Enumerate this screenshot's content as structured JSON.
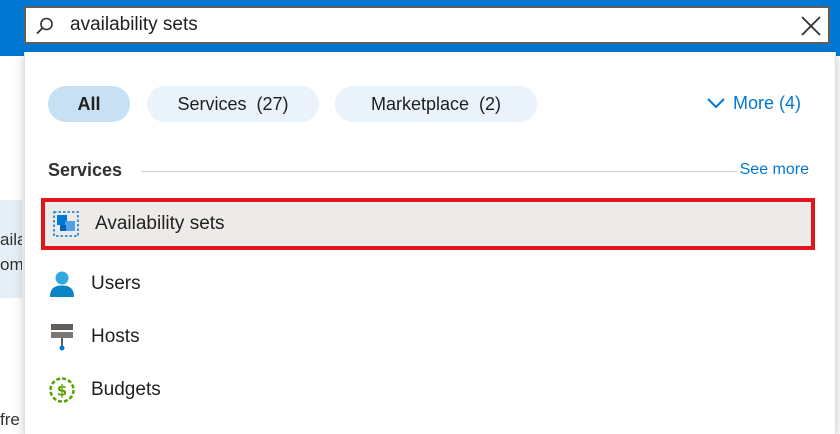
{
  "search": {
    "value": "availability sets"
  },
  "background": {
    "line1": "aila",
    "line2": "om",
    "line3": "fre"
  },
  "filters": {
    "all_label": "All",
    "services_label": "Services  (27)",
    "marketplace_label": "Marketplace  (2)",
    "more_label": "More (4)"
  },
  "services_section": {
    "title": "Services",
    "see_more": "See more",
    "items": [
      {
        "label": "Availability sets",
        "icon": "availability-sets-icon"
      },
      {
        "label": "Users",
        "icon": "user-icon"
      },
      {
        "label": "Hosts",
        "icon": "hosts-icon"
      },
      {
        "label": "Budgets",
        "icon": "budgets-icon"
      }
    ]
  },
  "colors": {
    "accent": "#0078d4",
    "highlight_border": "#e3151c",
    "pill_selected": "#c7e0f4",
    "pill": "#eaf2fb"
  }
}
